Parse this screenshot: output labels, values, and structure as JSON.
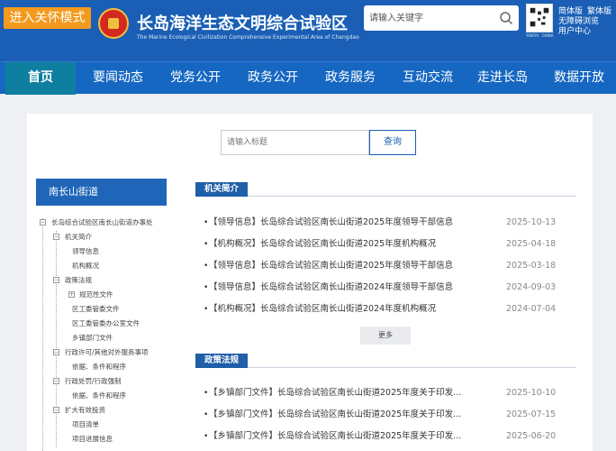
{
  "header": {
    "care_mode": "进入关怀模式",
    "title": "长岛海洋生态文明综合试验区",
    "subtitle": "The Marine Ecological Civilization Comprehensive Experimental Area of Changdao",
    "search_placeholder": "请输入关键字",
    "qr_label": "YANTAI · CHINA",
    "lang_simplified": "简体版",
    "lang_traditional": "繁体版",
    "accessible": "无障碍浏览",
    "user_center": "用户中心",
    "brand_color": "#1a5fb5",
    "care_color": "#f39a1e"
  },
  "nav": {
    "items": [
      {
        "label": "首页",
        "active": true
      },
      {
        "label": "要闻动态"
      },
      {
        "label": "党务公开"
      },
      {
        "label": "政务公开"
      },
      {
        "label": "政务服务"
      },
      {
        "label": "互动交流"
      },
      {
        "label": "走进长岛"
      },
      {
        "label": "数据开放"
      }
    ],
    "active_color": "#0f7fa0"
  },
  "main": {
    "title_search_placeholder": "请输入标题",
    "query_label": "查询"
  },
  "sidebar": {
    "heading": "南长山街道",
    "tree": {
      "root": "长岛综合试验区南长山街道办事处",
      "g1": "机关简介",
      "g1_1": "领导信息",
      "g1_2": "机构概况",
      "g2": "政策法规",
      "g2_1": "规范性文件",
      "g2_2": "区工委管委文件",
      "g2_3": "区工委管委办公室文件",
      "g2_4": "乡镇部门文件",
      "g3": "行政许可/其他对外服务事项",
      "g3_1": "依据、条件和程序",
      "g4": "行政处罚/行政强制",
      "g4_1": "依据、条件和程序",
      "g5": "扩大有效投资",
      "g5_1": "项目清单",
      "g5_2": "项目进展信息"
    }
  },
  "sections": {
    "jigou": {
      "title": "机关简介",
      "items": [
        {
          "title": "【领导信息】长岛综合试验区南长山街道2025年度领导干部信息",
          "date": "2025-10-13"
        },
        {
          "title": "【机构概况】长岛综合试验区南长山街道2025年度机构概况",
          "date": "2025-04-18"
        },
        {
          "title": "【领导信息】长岛综合试验区南长山街道2025年度领导干部信息",
          "date": "2025-03-18"
        },
        {
          "title": "【领导信息】长岛综合试验区南长山街道2024年度领导干部信息",
          "date": "2024-09-03"
        },
        {
          "title": "【机构概况】长岛综合试验区南长山街道2024年度机构概况",
          "date": "2024-07-04"
        }
      ],
      "more": "更多"
    },
    "zhengce": {
      "title": "政策法规",
      "items": [
        {
          "title": "【乡镇部门文件】长岛综合试验区南长山街道2025年度关于印发...",
          "date": "2025-10-10"
        },
        {
          "title": "【乡镇部门文件】长岛综合试验区南长山街道2025年度关于印发...",
          "date": "2025-07-15"
        },
        {
          "title": "【乡镇部门文件】长岛综合试验区南长山街道2025年度关于印发...",
          "date": "2025-06-20"
        }
      ]
    }
  }
}
